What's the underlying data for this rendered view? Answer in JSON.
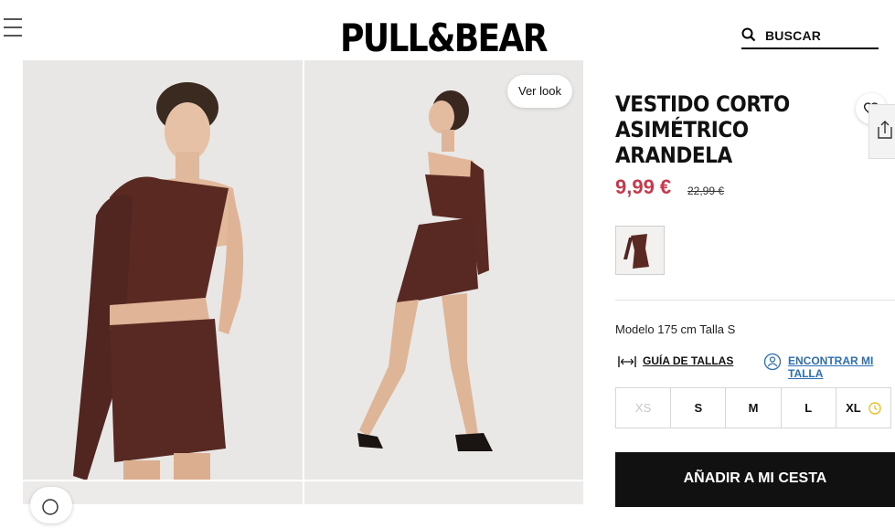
{
  "header": {
    "logo": "PULL&BEAR",
    "search_label": "BUSCAR"
  },
  "gallery": {
    "ver_look_label": "Ver look",
    "dress_color": "#5a2a22"
  },
  "product": {
    "title_lines": [
      "VESTIDO CORTO",
      "ASIMÉTRICO",
      "ARANDELA"
    ],
    "price": "9,99 €",
    "old_price": "22,99 €",
    "price_color": "#c9394e",
    "model_info": "Modelo 175 cm Talla S",
    "size_guide_label": "GUÍA DE TALLAS",
    "find_size_label": "ENCONTRAR MI TALLA",
    "sizes": [
      {
        "label": "XS",
        "available": false
      },
      {
        "label": "S",
        "available": true
      },
      {
        "label": "M",
        "available": true
      },
      {
        "label": "L",
        "available": true
      },
      {
        "label": "XL",
        "available": true,
        "low_stock": true
      }
    ],
    "add_to_cart_label": "AÑADIR A MI CESTA"
  }
}
